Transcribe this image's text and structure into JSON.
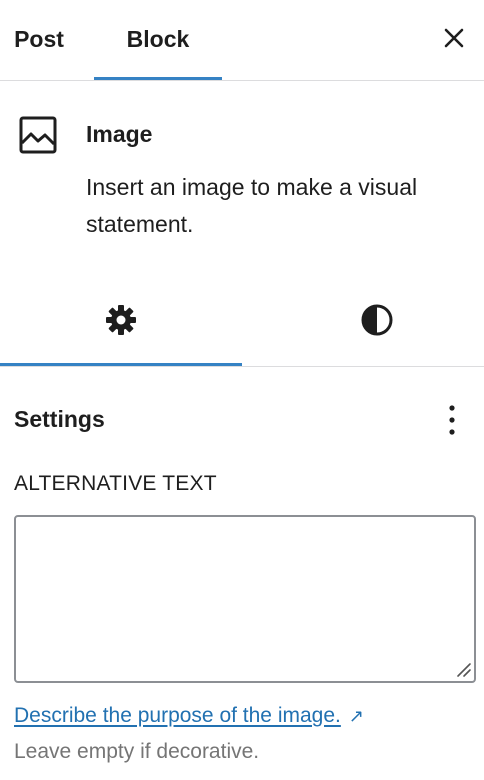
{
  "header": {
    "tabs": [
      {
        "label": "Post",
        "active": false
      },
      {
        "label": "Block",
        "active": true
      }
    ],
    "close_icon": "close-icon"
  },
  "block": {
    "icon": "image-icon",
    "title": "Image",
    "description": "Insert an image to make a visual statement."
  },
  "sub_tabs": [
    {
      "name": "settings",
      "icon": "gear-icon",
      "active": true
    },
    {
      "name": "styles",
      "icon": "contrast-icon",
      "active": false
    }
  ],
  "settings": {
    "title": "Settings",
    "more_icon": "more-vertical-icon"
  },
  "alt_text": {
    "label": "ALTERNATIVE TEXT",
    "value": "",
    "link_text": "Describe the purpose of the image.",
    "link_icon": "external-link-icon",
    "help": "Leave empty if decorative."
  },
  "colors": {
    "accent": "#3582c4",
    "link": "#2271b1",
    "muted": "#757575"
  }
}
